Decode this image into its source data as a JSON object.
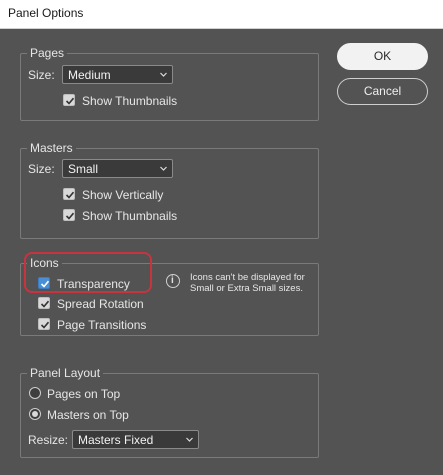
{
  "window": {
    "title": "Panel Options"
  },
  "buttons": {
    "ok": "OK",
    "cancel": "Cancel"
  },
  "pages": {
    "legend": "Pages",
    "size_label": "Size:",
    "size_value": "Medium",
    "show_thumbnails": {
      "label": "Show Thumbnails",
      "checked": true
    }
  },
  "masters": {
    "legend": "Masters",
    "size_label": "Size:",
    "size_value": "Small",
    "show_vertically": {
      "label": "Show Vertically",
      "checked": true
    },
    "show_thumbnails": {
      "label": "Show Thumbnails",
      "checked": true
    }
  },
  "icons": {
    "legend": "Icons",
    "transparency": {
      "label": "Transparency",
      "checked": true
    },
    "spread_rotation": {
      "label": "Spread Rotation",
      "checked": true
    },
    "page_transitions": {
      "label": "Page Transitions",
      "checked": true
    },
    "note": "Icons can't be displayed for Small or Extra Small sizes."
  },
  "panel_layout": {
    "legend": "Panel Layout",
    "pages_on_top": {
      "label": "Pages on Top",
      "selected": false
    },
    "masters_on_top": {
      "label": "Masters on Top",
      "selected": true
    },
    "resize_label": "Resize:",
    "resize_value": "Masters Fixed"
  },
  "colors": {
    "highlight": "#c7343f",
    "checkbox_accent": "#4a8fd6"
  }
}
